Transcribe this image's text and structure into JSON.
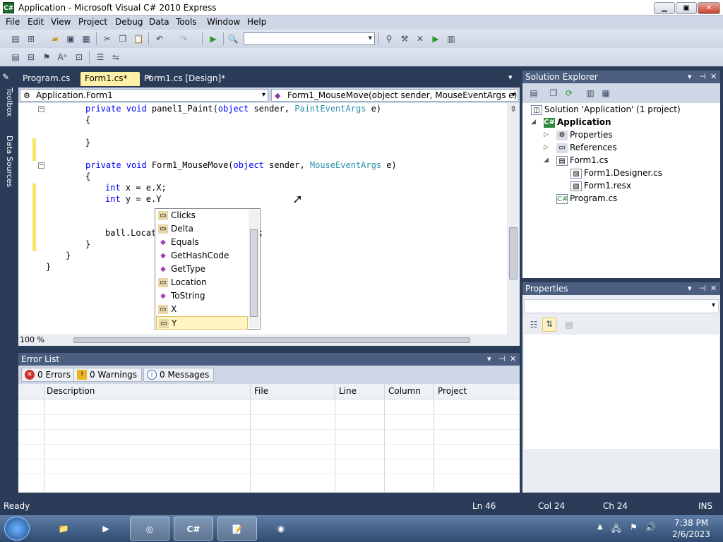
{
  "window": {
    "title": "Application - Microsoft Visual C# 2010 Express",
    "app_icon_text": "C#",
    "minimize": "▁",
    "maximize": "▣",
    "close": "✕"
  },
  "menu": [
    "File",
    "Edit",
    "View",
    "Project",
    "Debug",
    "Data",
    "Tools",
    "Window",
    "Help"
  ],
  "side_tabs": [
    "Toolbox",
    "Data Sources"
  ],
  "doc_tabs": [
    {
      "label": "Program.cs"
    },
    {
      "label": "Form1.cs*"
    },
    {
      "label": "Form1.cs [Design]*"
    }
  ],
  "tab_close_icon": "✕",
  "tab_overflow_icon": "▾",
  "nav": {
    "class_combo": "Application.Form1",
    "member_combo": "Form1_MouseMove(object sender, MouseEventArgs e)"
  },
  "code": {
    "line1_kw": "private void",
    "line1_name": " panel1_Paint(",
    "line1_kw2": "object",
    "line1_mid": " sender, ",
    "line1_type": "PaintEventArgs",
    "line1_end": " e)",
    "line2": "{",
    "line3": "}",
    "line4_kw": "private void",
    "line4_name": " Form1_MouseMove(",
    "line4_kw2": "object",
    "line4_mid": " sender, ",
    "line4_type": "MouseEventArgs",
    "line4_end": " e)",
    "line5": "{",
    "line6_kw": "int",
    "line6_rest": " x = e.X;",
    "line7_kw": "int",
    "line7_rest": " y = e.Y",
    "line8": "ball.Locat",
    "line8_tail": ";",
    "line9": "}",
    "line10": "}",
    "line11": "}"
  },
  "intellisense": {
    "items": [
      {
        "label": "Clicks",
        "kind": "property"
      },
      {
        "label": "Delta",
        "kind": "property"
      },
      {
        "label": "Equals",
        "kind": "method"
      },
      {
        "label": "GetHashCode",
        "kind": "method"
      },
      {
        "label": "GetType",
        "kind": "method"
      },
      {
        "label": "Location",
        "kind": "property"
      },
      {
        "label": "ToString",
        "kind": "method"
      },
      {
        "label": "X",
        "kind": "property"
      },
      {
        "label": "Y",
        "kind": "property"
      }
    ],
    "selected": "Y"
  },
  "editor": {
    "zoom": "100 %"
  },
  "error_list": {
    "title": "Error List",
    "errors": "0 Errors",
    "warnings": "0 Warnings",
    "messages": "0 Messages",
    "columns": [
      "Description",
      "File",
      "Line",
      "Column",
      "Project"
    ]
  },
  "solution_explorer": {
    "title": "Solution Explorer",
    "solution": "Solution 'Application' (1 project)",
    "project": "Application",
    "nodes": [
      "Properties",
      "References",
      "Form1.cs",
      "Form1.Designer.cs",
      "Form1.resx",
      "Program.cs"
    ]
  },
  "properties_panel": {
    "title": "Properties"
  },
  "pane_controls": {
    "dropdown": "▾",
    "pin": "⊣",
    "close": "✕"
  },
  "status": {
    "ready": "Ready",
    "ln": "Ln 46",
    "col": "Col 24",
    "ch": "Ch 24",
    "ins": "INS"
  },
  "clock": {
    "time": "7:38 PM",
    "date": "2/6/2023"
  },
  "tray_icons": [
    "▲",
    "🖧",
    "⚑",
    "🔊"
  ],
  "taskbar": [
    "Explorer",
    "Media Player",
    "Chrome",
    "C#",
    "Notepad++",
    "Firefox"
  ],
  "taskbar_glyphs": [
    "📁",
    "▶",
    "◎",
    "C#",
    "📝",
    "◉"
  ]
}
